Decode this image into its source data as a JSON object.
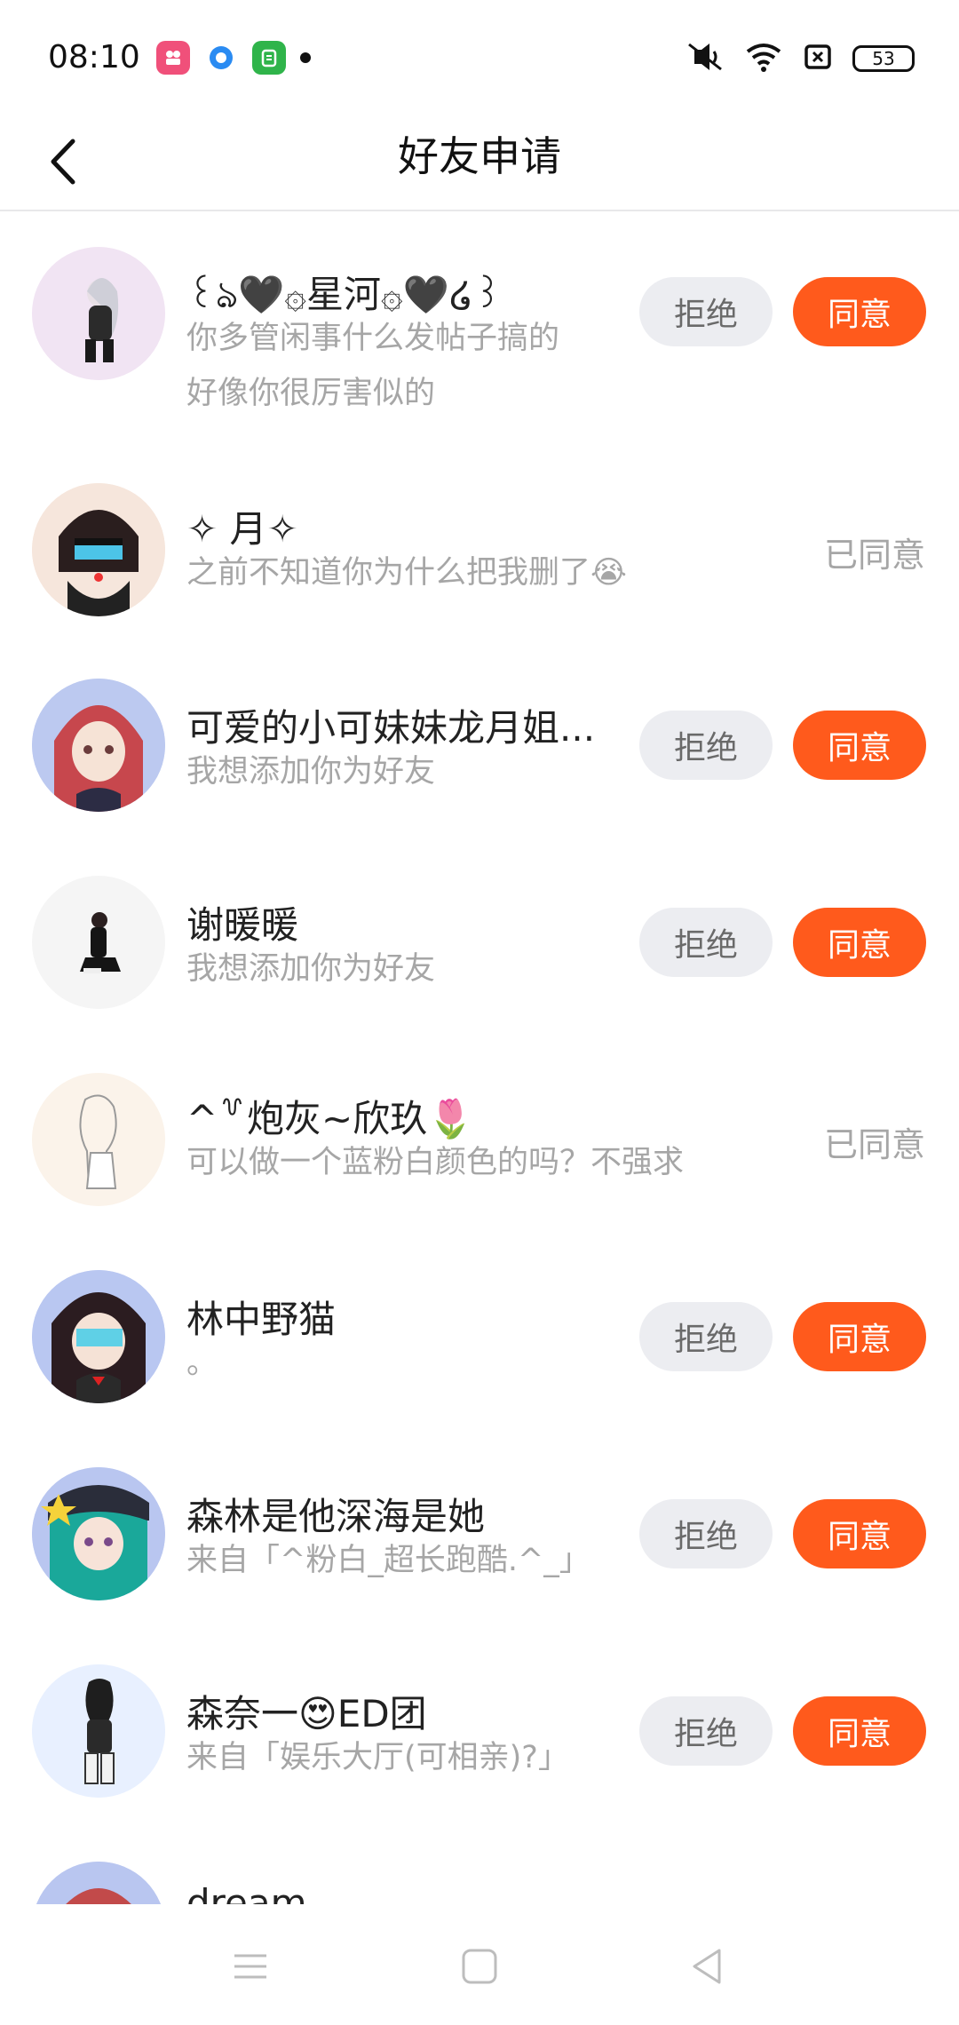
{
  "status_bar": {
    "time": "08:10",
    "battery": "53",
    "icons": [
      "app-icon-pink",
      "app-icon-blue",
      "app-icon-green",
      "notification-dot",
      "mute-icon",
      "wifi-icon",
      "sim-icon",
      "battery-icon"
    ]
  },
  "header": {
    "title": "好友申请",
    "back_icon": "chevron-left-icon"
  },
  "labels": {
    "reject": "拒绝",
    "accept": "同意",
    "accepted": "已同意"
  },
  "requests": [
    {
      "name": "꒰ঌ🖤۞星河۞🖤໒꒱",
      "message_1": "你多管闲事什么发帖子搞的",
      "message_2": "好像你很厉害似的",
      "status": "pending"
    },
    {
      "name": "✧ 月✧",
      "message_1": "之前不知道你为什么把我删了😭",
      "status": "accepted"
    },
    {
      "name": "可爱的小可妹妹龙月姐...",
      "message_1": "我想添加你为好友",
      "status": "pending"
    },
    {
      "name": "谢暖暖",
      "message_1": "我想添加你为好友",
      "status": "pending"
    },
    {
      "name": "^꒷炮灰~欣玖🌷",
      "message_1": "可以做一个蓝粉白颜色的吗？不强求",
      "status": "accepted"
    },
    {
      "name": "林中野猫",
      "message_1": "。",
      "status": "pending"
    },
    {
      "name": "森林是他深海是她",
      "message_1": "来自「^粉白_超长跑酷.^_」",
      "status": "pending"
    },
    {
      "name": "森奈一😍ED团",
      "message_1": "来自「娱乐大厅(可相亲)?」",
      "status": "pending"
    },
    {
      "name": "dream",
      "status": "partial"
    }
  ],
  "nav": {
    "menu_icon": "menu-icon",
    "home_icon": "home-square-icon",
    "back_icon": "back-triangle-icon"
  },
  "colors": {
    "accent": "#ff5a1c",
    "reject_bg": "#ecedf1",
    "muted_text": "#a6a6a6"
  }
}
